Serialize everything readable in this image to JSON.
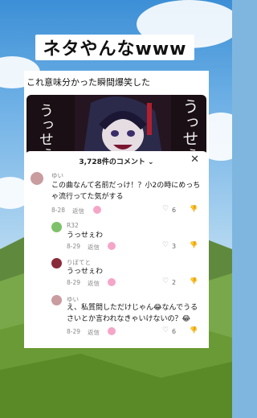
{
  "overlay_title": "ネタやんなwww",
  "caption": "これ意味分かった瞬間爆笑した",
  "video_text": {
    "left": "うっせぇ",
    "right": "うっせぇ"
  },
  "comments_panel": {
    "count": "3,728件のコメント",
    "comments": [
      {
        "user": "ゆい",
        "text_line1": "この曲なんて名前だっけ！？小2の時にめっち",
        "text_line2": "ゃ流行ってた気がする",
        "date": "8-28",
        "reply": "返信",
        "likes": "6"
      },
      {
        "user": "R32",
        "text_line1": "うっせぇわ",
        "text_line2": "",
        "date": "8-29",
        "reply": "返信",
        "likes": "3"
      },
      {
        "user": "りぼてと",
        "text_line1": "うっせぇわ",
        "text_line2": "",
        "date": "8-29",
        "reply": "返信",
        "likes": "2"
      },
      {
        "user": "ゆい",
        "text_line1": "え、私質問しただけじゃん😂なんでうる",
        "text_line2": "さいとか言われなきゃいけないの？😂",
        "date": "8-29",
        "reply": "返信",
        "likes": "6"
      }
    ]
  }
}
